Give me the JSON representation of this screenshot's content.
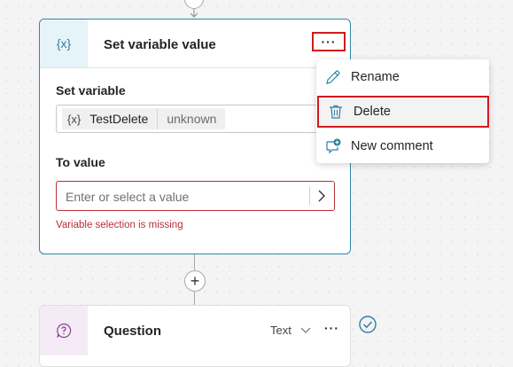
{
  "set_variable_node": {
    "icon_text": "{x}",
    "title": "Set variable value",
    "more_label": "···",
    "set_variable_label": "Set variable",
    "variable_chip": {
      "icon_text": "{x}",
      "name": "TestDelete",
      "type": "unknown"
    },
    "to_value_label": "To value",
    "value_placeholder": "Enter or select a value",
    "error_message": "Variable selection is missing"
  },
  "context_menu": {
    "items": [
      {
        "label": "Rename",
        "icon": "pencil-icon"
      },
      {
        "label": "Delete",
        "icon": "trash-icon"
      },
      {
        "label": "New comment",
        "icon": "comment-add-icon"
      }
    ]
  },
  "add_button_label": "+",
  "question_node": {
    "title": "Question",
    "type_label": "Text",
    "more_label": "···",
    "icon": "question-bubble-icon",
    "status_icon": "check-circle-icon"
  },
  "colors": {
    "accent": "#2f87a7",
    "error": "#b72f36",
    "highlight_outline": "#d01b1b"
  }
}
